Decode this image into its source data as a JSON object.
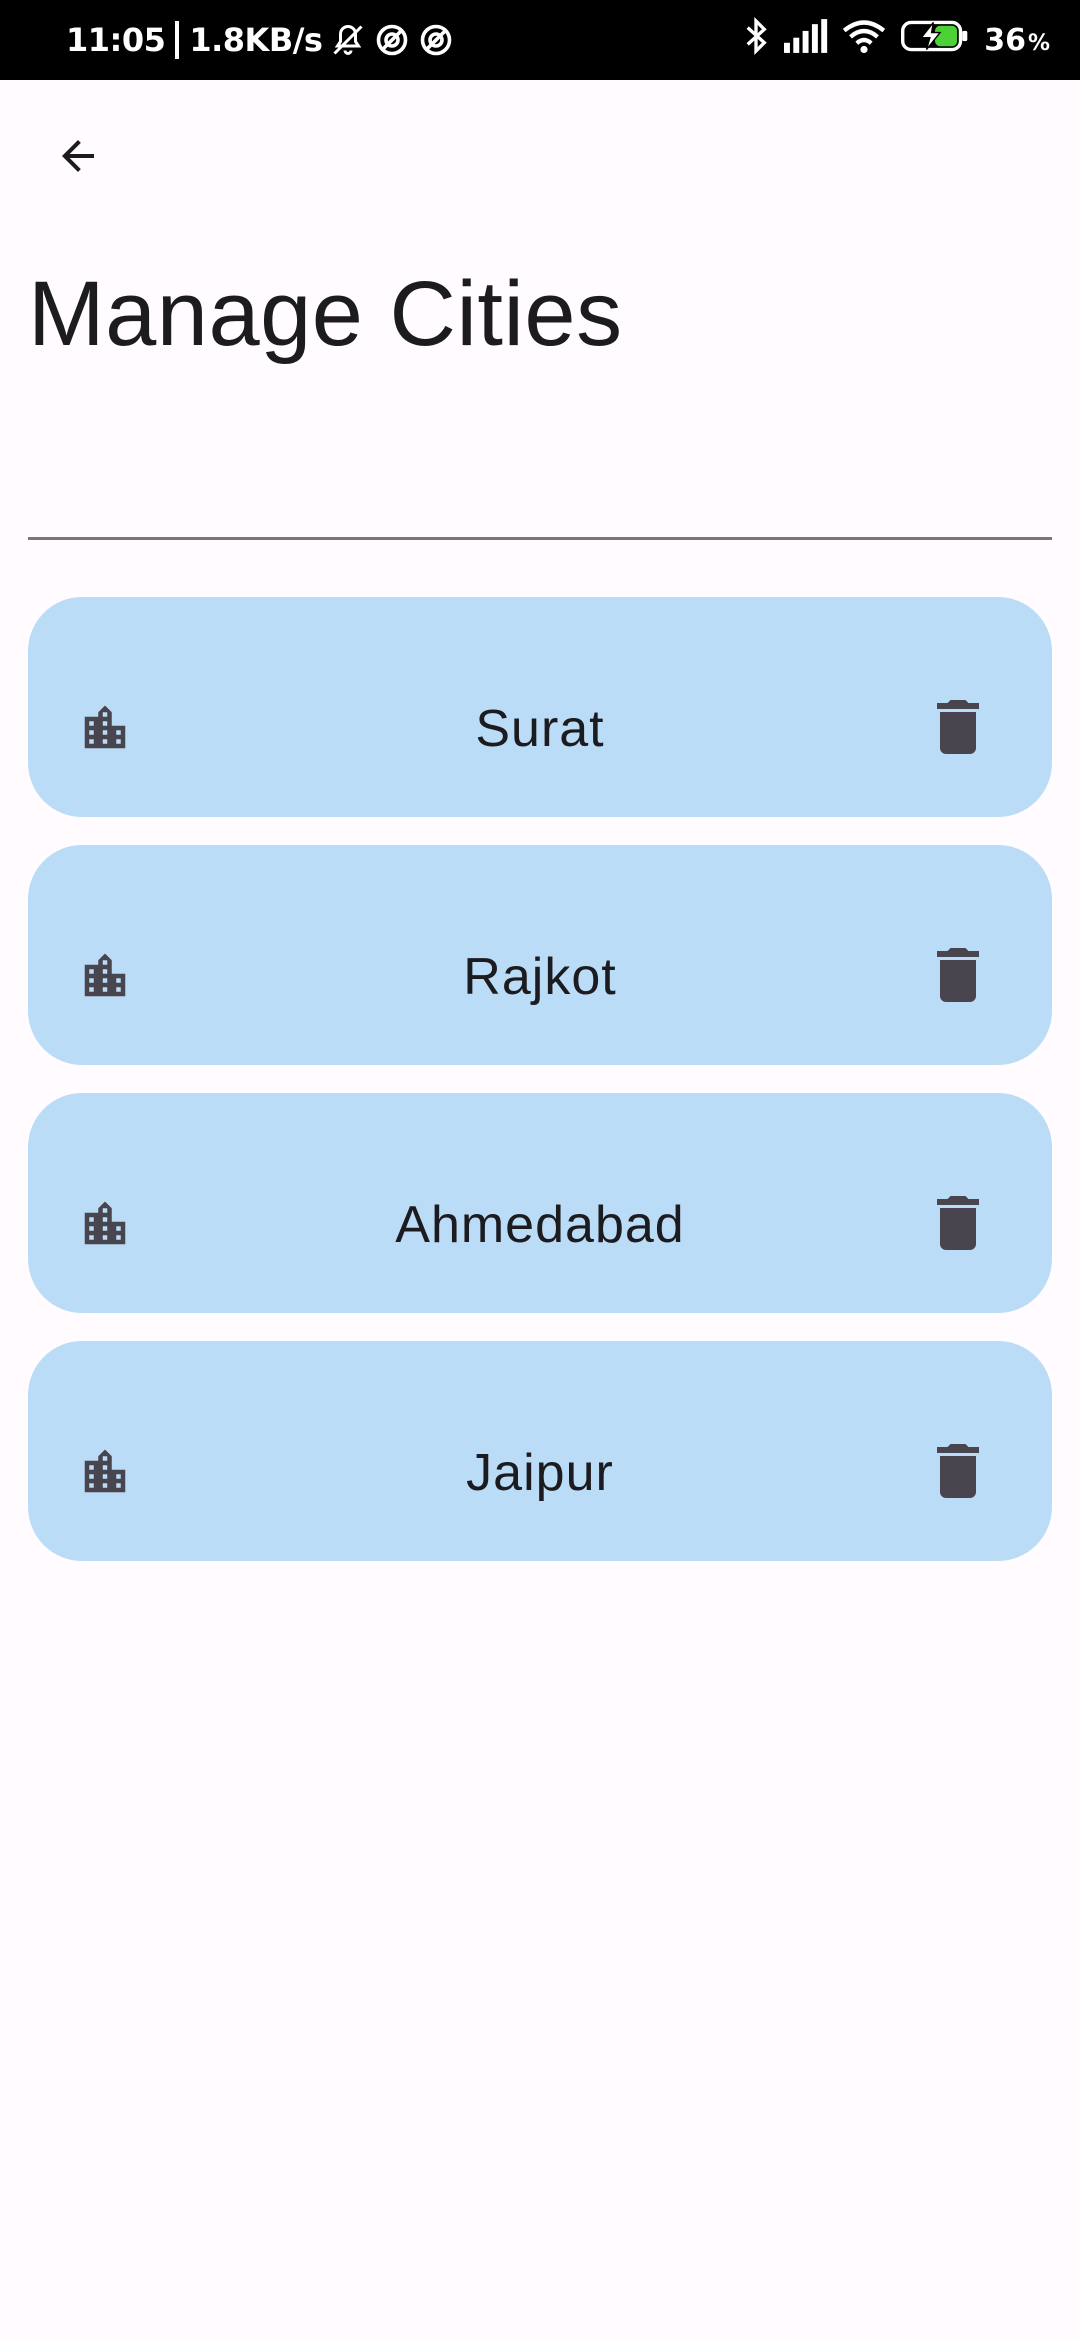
{
  "status_bar": {
    "time": "11:05",
    "net_speed": "1.8KB/s",
    "battery_percent": "36",
    "battery_percent_sign": "%",
    "icons": [
      "mute-icon",
      "focus-icon",
      "focus-icon",
      "bluetooth-icon",
      "signal-icon",
      "wifi-icon",
      "battery-charging-icon"
    ]
  },
  "app_bar": {
    "back_icon": "arrow-back-icon",
    "title": "Manage Cities"
  },
  "input": {
    "value": "",
    "placeholder": ""
  },
  "cities": [
    {
      "name": "Surat",
      "icon": "building-icon",
      "action_icon": "delete-icon"
    },
    {
      "name": "Rajkot",
      "icon": "building-icon",
      "action_icon": "delete-icon"
    },
    {
      "name": "Ahmedabad",
      "icon": "building-icon",
      "action_icon": "delete-icon"
    },
    {
      "name": "Jaipur",
      "icon": "building-icon",
      "action_icon": "delete-icon"
    }
  ],
  "colors": {
    "background": "#fffbfe",
    "card": "#bbdcf7",
    "icon": "#49454f",
    "text": "#1c1b1f",
    "battery_charge": "#4cd137"
  }
}
